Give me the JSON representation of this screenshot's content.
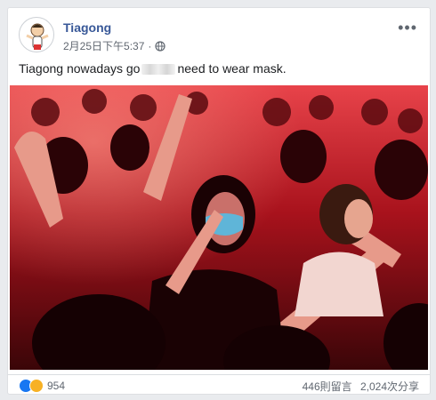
{
  "post": {
    "author": "Tiagong",
    "timestamp": "2月25日下午5:37",
    "privacy_icon": "globe-icon",
    "more_icon": "more-dots-icon",
    "text_before": "Tiagong nowadays go",
    "text_after": "need to wear mask."
  },
  "footer": {
    "reaction_count": "954",
    "comments": "446則留言",
    "shares": "2,024次分享"
  },
  "colors": {
    "author": "#385898",
    "photo_tint": "#d21a22",
    "mask": "#5fb5d8"
  }
}
